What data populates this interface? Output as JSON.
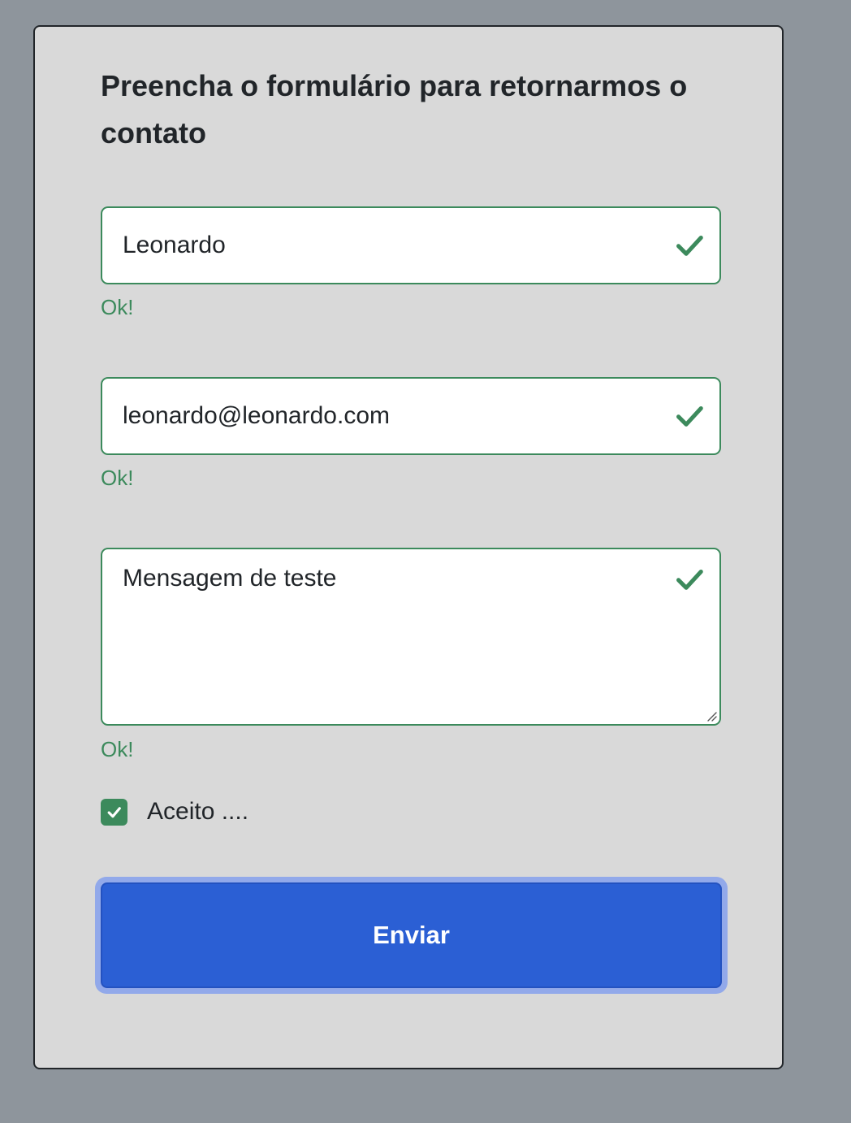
{
  "form": {
    "title": "Preencha o formulário para retornarmos o contato",
    "name_field": {
      "value": "Leonardo",
      "feedback": "Ok!",
      "state_icon": "check-icon"
    },
    "email_field": {
      "value": "leonardo@leonardo.com",
      "feedback": "Ok!",
      "state_icon": "check-icon"
    },
    "message_field": {
      "value": "Mensagem de teste",
      "feedback": "Ok!",
      "state_icon": "check-icon"
    },
    "accept_checkbox": {
      "label": "Aceito ....",
      "checked": true
    },
    "submit_label": "Enviar"
  },
  "colors": {
    "page_background": "#8e959c",
    "card_background": "#d9d9d9",
    "valid_green": "#3c8a5c",
    "primary_blue": "#2b5fd4",
    "focus_ring": "#92a9ea",
    "text_dark": "#212529"
  }
}
